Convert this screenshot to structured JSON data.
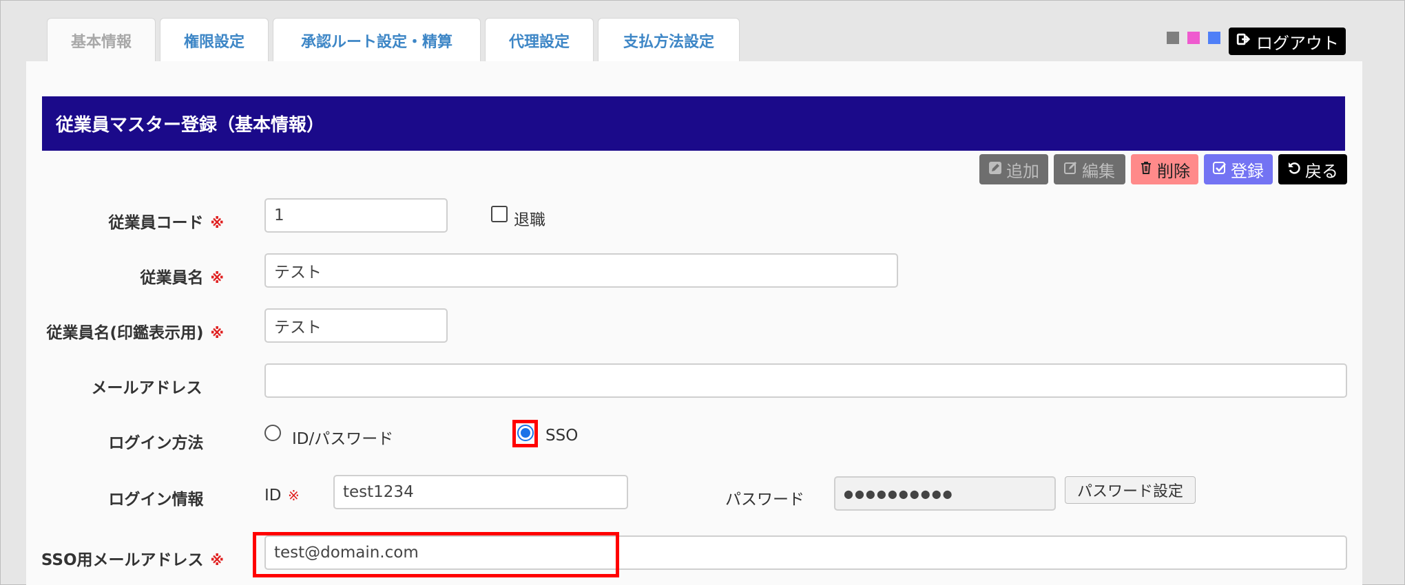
{
  "tabs": [
    {
      "label": "基本情報",
      "active": true
    },
    {
      "label": "権限設定"
    },
    {
      "label": "承認ルート設定・精算"
    },
    {
      "label": "代理設定"
    },
    {
      "label": "支払方法設定"
    }
  ],
  "theme_swatches": [
    "#7f7f7f",
    "#ef5bcf",
    "#4f7ff7"
  ],
  "logout_label": "ログアウト",
  "page_title": "従業員マスター登録（基本情報）",
  "actions": {
    "add": "追加",
    "edit": "編集",
    "delete": "削除",
    "register": "登録",
    "back": "戻る"
  },
  "required_mark": "※",
  "form": {
    "employee_code": {
      "label": "従業員コード",
      "value": "1"
    },
    "retired": {
      "label": "退職",
      "checked": false
    },
    "employee_name": {
      "label": "従業員名",
      "value": "テスト"
    },
    "employee_name_seal": {
      "label": "従業員名(印鑑表示用)",
      "value": "テスト"
    },
    "email": {
      "label": "メールアドレス",
      "value": ""
    },
    "login_method": {
      "label": "ログイン方法",
      "options": [
        "ID/パスワード",
        "SSO"
      ],
      "selected": "SSO"
    },
    "login_info": {
      "label": "ログイン情報",
      "id_label": "ID",
      "id_value": "test1234",
      "password_label": "パスワード",
      "password_value": "●●●●●●●●●●",
      "password_button": "パスワード設定"
    },
    "sso_email": {
      "label": "SSO用メールアドレス",
      "value": "test@domain.com"
    }
  }
}
